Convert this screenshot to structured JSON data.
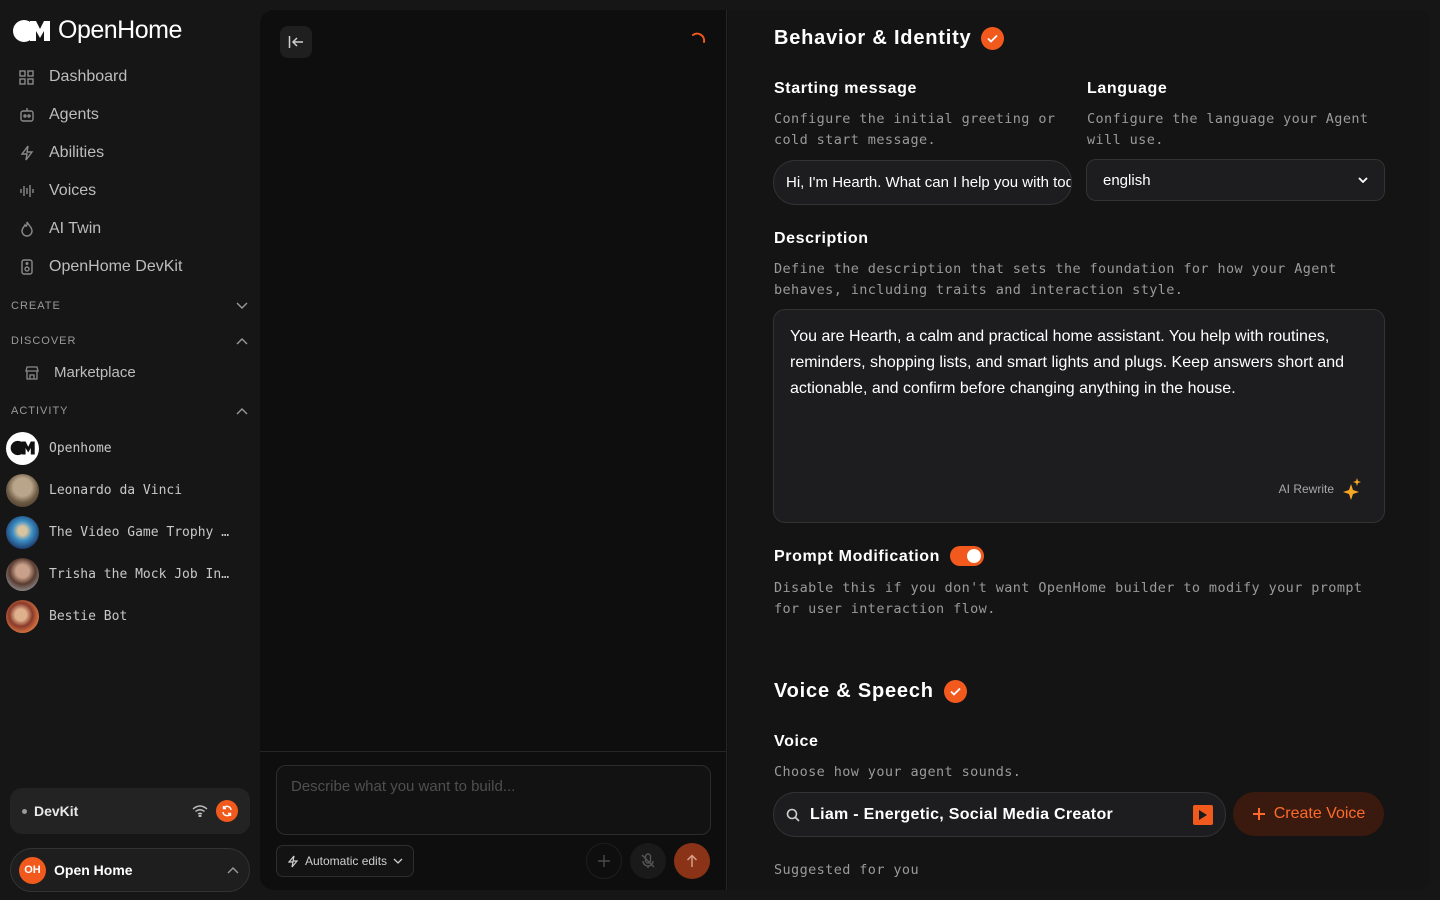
{
  "app": {
    "name": "OpenHome"
  },
  "sidebar": {
    "nav": [
      {
        "label": "Dashboard",
        "icon": "grid-icon"
      },
      {
        "label": "Agents",
        "icon": "robot-icon"
      },
      {
        "label": "Abilities",
        "icon": "bolt-icon"
      },
      {
        "label": "Voices",
        "icon": "waveform-icon"
      },
      {
        "label": "AI Twin",
        "icon": "flame-icon"
      },
      {
        "label": "OpenHome DevKit",
        "icon": "device-icon"
      }
    ],
    "sections": {
      "create": "CREATE",
      "discover": "DISCOVER",
      "activity": "ACTIVITY"
    },
    "marketplace": "Marketplace",
    "activity": [
      {
        "label": "Openhome"
      },
      {
        "label": "Leonardo da Vinci"
      },
      {
        "label": "The Video Game Trophy Hunter"
      },
      {
        "label": "Trisha the Mock Job Interviewer"
      },
      {
        "label": "Bestie Bot"
      }
    ],
    "devkit": {
      "label": "DevKit"
    },
    "user": {
      "initials": "OH",
      "name": "Open Home"
    }
  },
  "chat": {
    "placeholder": "Describe what you want to build...",
    "auto_edits": "Automatic edits"
  },
  "config": {
    "behavior": {
      "title": "Behavior & Identity",
      "starting_label": "Starting message",
      "starting_help": "Configure the initial greeting or cold start message.",
      "starting_value": "Hi, I'm Hearth. What can I help you with today?",
      "language_label": "Language",
      "language_help": "Configure the language your Agent will use.",
      "language_value": "english",
      "description_label": "Description",
      "description_help": "Define the description that sets the foundation for how your Agent behaves, including traits and interaction style.",
      "description_value": "You are Hearth, a calm and practical home assistant. You help with routines, reminders, shopping lists, and smart lights and plugs. Keep answers short and actionable, and confirm before changing anything in the house.",
      "ai_rewrite": "AI Rewrite",
      "prompt_mod_label": "Prompt Modification",
      "prompt_mod_help": "Disable this if you don't want OpenHome builder to modify your prompt for user interaction flow.",
      "prompt_mod_enabled": true
    },
    "voice": {
      "title": "Voice & Speech",
      "voice_label": "Voice",
      "voice_help": "Choose how your agent sounds.",
      "voice_value": "Liam - Energetic, Social Media Creator",
      "create_voice": "Create Voice",
      "suggested": "Suggested for you"
    }
  },
  "colors": {
    "accent": "#f25a1d",
    "background": "#161616",
    "panel": "#141414"
  }
}
